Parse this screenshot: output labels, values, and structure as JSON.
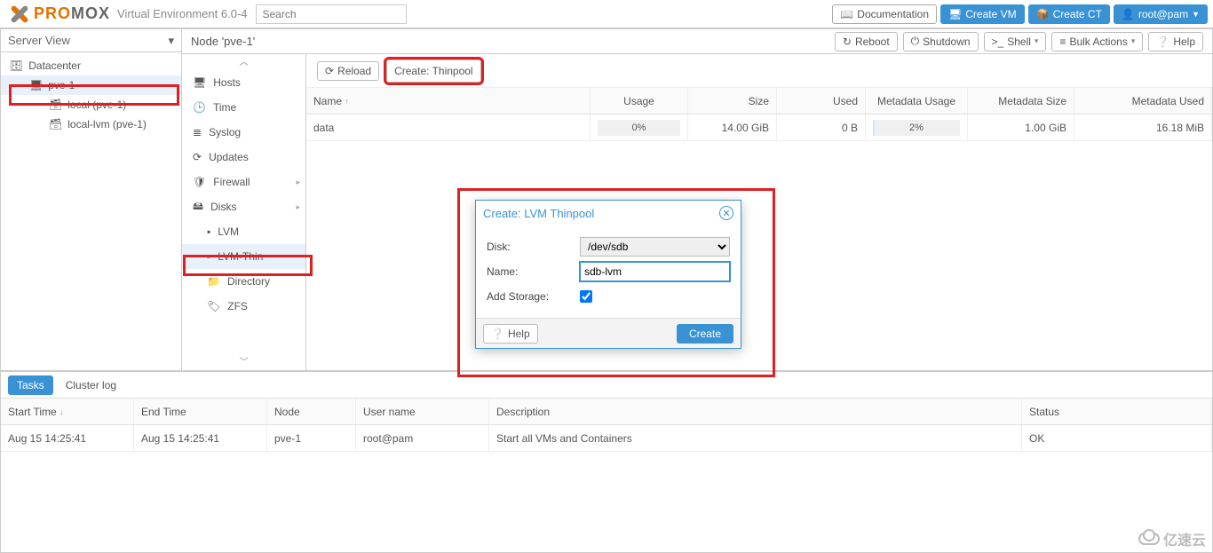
{
  "header": {
    "logo_left": "PRO",
    "logo_right": "MOX",
    "env": "Virtual Environment 6.0-4",
    "search_placeholder": "Search",
    "buttons": {
      "doc": "Documentation",
      "createvm": "Create VM",
      "createct": "Create CT",
      "user": "root@pam"
    }
  },
  "tree": {
    "view": "Server View",
    "items": [
      {
        "label": "Datacenter",
        "icon": "🗄",
        "indent": 0
      },
      {
        "label": "pve-1",
        "icon": "🖥",
        "indent": 1,
        "selected": true
      },
      {
        "label": "local (pve-1)",
        "icon": "🗃",
        "indent": 2
      },
      {
        "label": "local-lvm (pve-1)",
        "icon": "🗃",
        "indent": 2
      }
    ]
  },
  "content_title": "Node 'pve-1'",
  "content_actions": {
    "reboot": "Reboot",
    "shutdown": "Shutdown",
    "shell": "Shell",
    "bulk": "Bulk Actions",
    "help": "Help"
  },
  "sidemenu": [
    {
      "label": "Hosts",
      "icon": "🖥"
    },
    {
      "label": "Time",
      "icon": "🕒"
    },
    {
      "label": "Syslog",
      "icon": "≣"
    },
    {
      "label": "Updates",
      "icon": "⟳"
    },
    {
      "label": "Firewall",
      "icon": "🛡",
      "expand": true
    },
    {
      "label": "Disks",
      "icon": "🖴",
      "expand": false
    },
    {
      "label": "LVM",
      "icon": "▪",
      "sub": true
    },
    {
      "label": "LVM-Thin",
      "icon": "▫",
      "sub": true,
      "selected": true
    },
    {
      "label": "Directory",
      "icon": "📁",
      "sub": true
    },
    {
      "label": "ZFS",
      "icon": "🏷",
      "sub": true
    }
  ],
  "toolbar": {
    "reload": "Reload",
    "create": "Create: Thinpool"
  },
  "grid": {
    "headers": {
      "name": "Name",
      "usage": "Usage",
      "size": "Size",
      "used": "Used",
      "musage": "Metadata Usage",
      "msize": "Metadata Size",
      "mused": "Metadata Used"
    },
    "rows": [
      {
        "name": "data",
        "usage": "0%",
        "usage_pct": 0,
        "size": "14.00 GiB",
        "used": "0 B",
        "musage": "2%",
        "musage_pct": 2,
        "msize": "1.00 GiB",
        "mused": "16.18 MiB"
      }
    ]
  },
  "modal": {
    "title": "Create: LVM Thinpool",
    "disk_label": "Disk:",
    "disk_value": "/dev/sdb",
    "name_label": "Name:",
    "name_value": "sdb-lvm",
    "add_storage_label": "Add Storage:",
    "add_storage_checked": true,
    "help": "Help",
    "create": "Create"
  },
  "log": {
    "tabs": {
      "tasks": "Tasks",
      "cluster": "Cluster log"
    },
    "headers": {
      "start": "Start Time",
      "end": "End Time",
      "node": "Node",
      "user": "User name",
      "desc": "Description",
      "status": "Status"
    },
    "rows": [
      {
        "start": "Aug 15 14:25:41",
        "end": "Aug 15 14:25:41",
        "node": "pve-1",
        "user": "root@pam",
        "desc": "Start all VMs and Containers",
        "status": "OK"
      }
    ]
  },
  "watermark": "亿速云"
}
